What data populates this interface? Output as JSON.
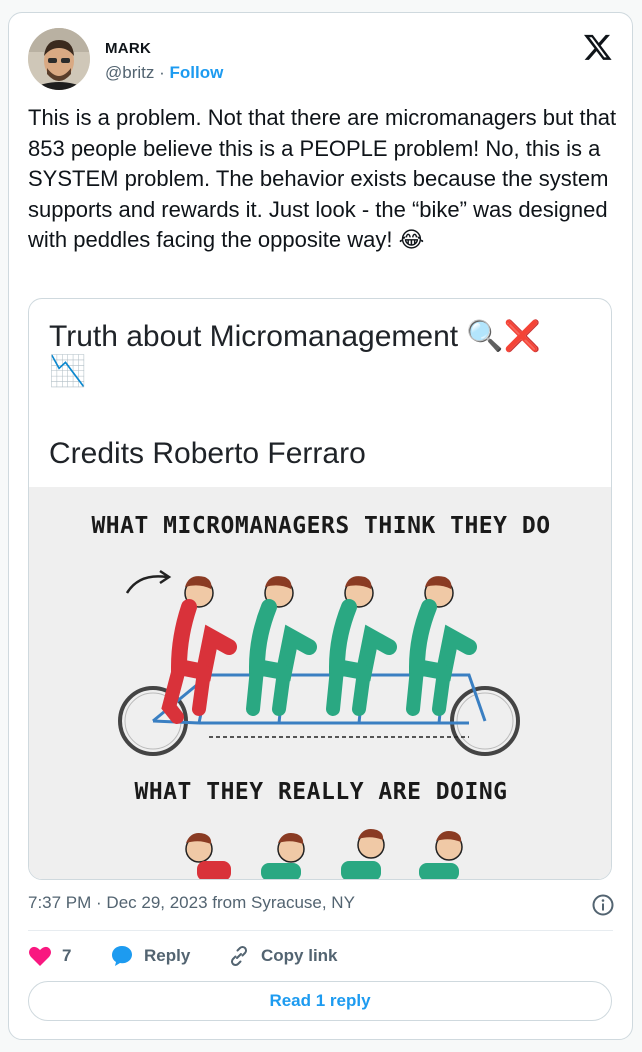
{
  "author": {
    "name": "MARK",
    "handle": "@britz",
    "separator": " · ",
    "follow_label": "Follow"
  },
  "tweet": {
    "text": "This is a problem. Not that there are micromanagers but that 853 people believe this is a PEOPLE problem! No, this is a SYSTEM problem. The behavior exists because the system supports and rewards it. Just look - the “bike” was designed with peddles facing the opposite way! 😂"
  },
  "media": {
    "title": "Truth about Micromanagement 🔍❌",
    "title_emoji_line2": "📉",
    "credits": "Credits Roberto Ferraro",
    "caption_top": "WHAT MICROMANAGERS THINK THEY DO",
    "caption_bottom": "WHAT THEY REALLY ARE DOING"
  },
  "meta": {
    "timestamp": "7:37 PM · Dec 29, 2023 from Syracuse, NY"
  },
  "actions": {
    "like_count": "7",
    "reply_label": "Reply",
    "copy_link_label": "Copy link"
  },
  "read_replies_label": "Read 1 reply",
  "colors": {
    "accent": "#1d9bf0",
    "like": "#f91880",
    "text": "#0f1419",
    "muted": "#536471",
    "boss_red": "#d9323a",
    "worker_green": "#2aa882"
  },
  "icons": [
    "x-logo-icon",
    "info-icon",
    "heart-icon",
    "reply-bubble-icon",
    "link-icon"
  ]
}
